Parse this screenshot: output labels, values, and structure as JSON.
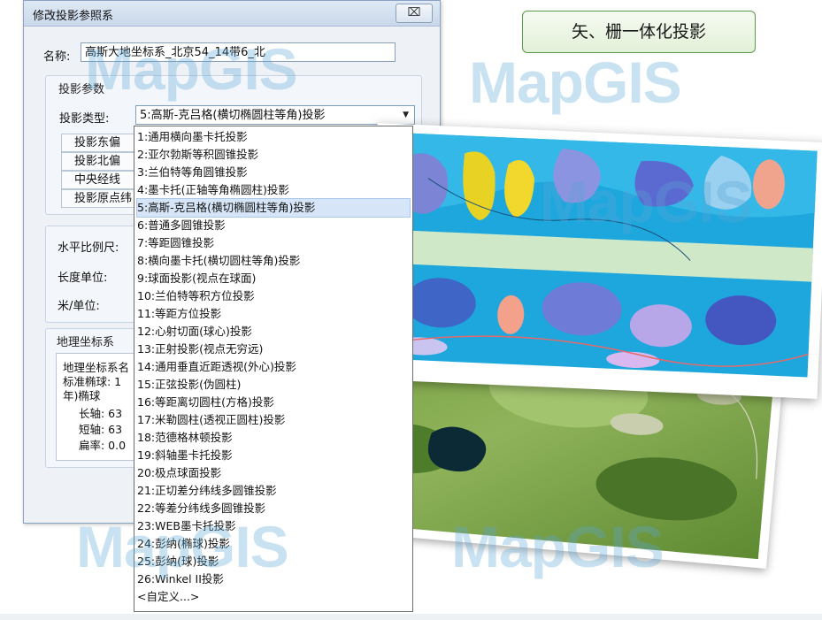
{
  "dialog": {
    "title": "修改投影参照系",
    "close_label": "⌧",
    "name_label": "名称:",
    "name_value": "高斯大地坐标系_北京54_14带6_北",
    "projection_group_title": "投影参数",
    "projection_type_label": "投影类型:",
    "projection_type_value": "5:高斯-克吕格(横切椭圆柱等角)投影",
    "param_rows": [
      "投影东偏",
      "投影北偏",
      "中央经线",
      "投影原点纬"
    ],
    "scale_label": "水平比例尺:",
    "length_unit_label": "长度单位:",
    "meter_unit_label": "米/单位:",
    "geo_group_title": "地理坐标系",
    "geo_info_lines": [
      "地理坐标系名",
      "标准椭球: 1",
      "年)椭球",
      "长轴: 63",
      "短轴: 63",
      "扁率: 0.0"
    ]
  },
  "dropdown": {
    "selected_index": 4,
    "options": [
      "1:通用横向墨卡托投影",
      "2:亚尔勃斯等积圆锥投影",
      "3:兰伯特等角圆锥投影",
      "4:墨卡托(正轴等角椭圆柱)投影",
      "5:高斯-克吕格(横切椭圆柱等角)投影",
      "6:普通多圆锥投影",
      "7:等距圆锥投影",
      "8:横向墨卡托(横切圆柱等角)投影",
      "9:球面投影(视点在球面)",
      "10:兰伯特等积方位投影",
      "11:等距方位投影",
      "12:心射切面(球心)投影",
      "13:正射投影(视点无穷远)",
      "14:通用垂直近距透视(外心)投影",
      "15:正弦投影(伪圆柱)",
      "16:等距离切圆柱(方格)投影",
      "17:米勒圆柱(透视正圆柱)投影",
      "18:范德格林顿投影",
      "19:斜轴墨卡托投影",
      "20:极点球面投影",
      "21:正切差分纬线多圆锥投影",
      "22:等差分纬线多圆锥投影",
      "23:WEB墨卡托投影",
      "24:彭纳(椭球)投影",
      "25:彭纳(球)投影",
      "26:Winkel II投影",
      "<自定义...>"
    ]
  },
  "banner": {
    "text": "矢、栅一体化投影"
  },
  "watermark": {
    "text": "MapGIS"
  },
  "colors": {
    "tag_border": "#5c9a4a",
    "selection": "#d6e6f8",
    "watermark": "#5aa6d6"
  }
}
